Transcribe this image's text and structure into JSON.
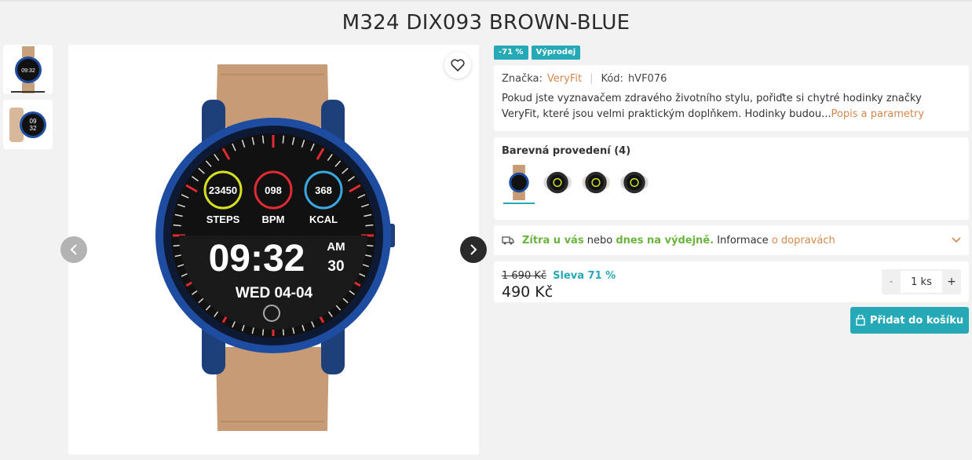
{
  "product": {
    "title": "M324 DIX093 BROWN-BLUE"
  },
  "gallery": {
    "thumbnails": [
      "watch-front",
      "watch-side"
    ],
    "watch_face": {
      "steps": "23450",
      "steps_label": "STEPS",
      "bpm": "098",
      "bpm_label": "BPM",
      "kcal": "368",
      "kcal_label": "KCAL",
      "time": "09:32",
      "ampm": "AM",
      "seconds": "30",
      "date": "WED 04-04"
    }
  },
  "badges": {
    "discount": "-71 %",
    "sale": "Výprodej"
  },
  "info": {
    "brand_label": "Značka:",
    "brand": "VeryFit",
    "code_label": "Kód:",
    "code": "hVF076",
    "description": "Pokud jste vyznavačem zdravého životního stylu, pořiďte si chytré hodinky značky VeryFit, které jsou velmi praktickým doplňkem. Hodinky budou...",
    "more_link": "Popis a parametry"
  },
  "variants": {
    "title": "Barevná provedení (4)",
    "items": [
      "brown-blue",
      "black-white",
      "black-white",
      "black-white"
    ]
  },
  "delivery": {
    "tomorrow": "Zítra u vás",
    "or": "nebo",
    "today": "dnes na výdejně.",
    "info": "Informace",
    "info_link": "o dopravách"
  },
  "price": {
    "old": "1 690 Kč",
    "discount": "Sleva 71 %",
    "current": "490 Kč",
    "qty": "1 ks",
    "minus": "-",
    "plus": "+"
  },
  "cart": {
    "button": "Přidat do košíku"
  },
  "colors": {
    "accent": "#26a9b6",
    "link": "#d4874d",
    "green": "#6bb33f"
  }
}
